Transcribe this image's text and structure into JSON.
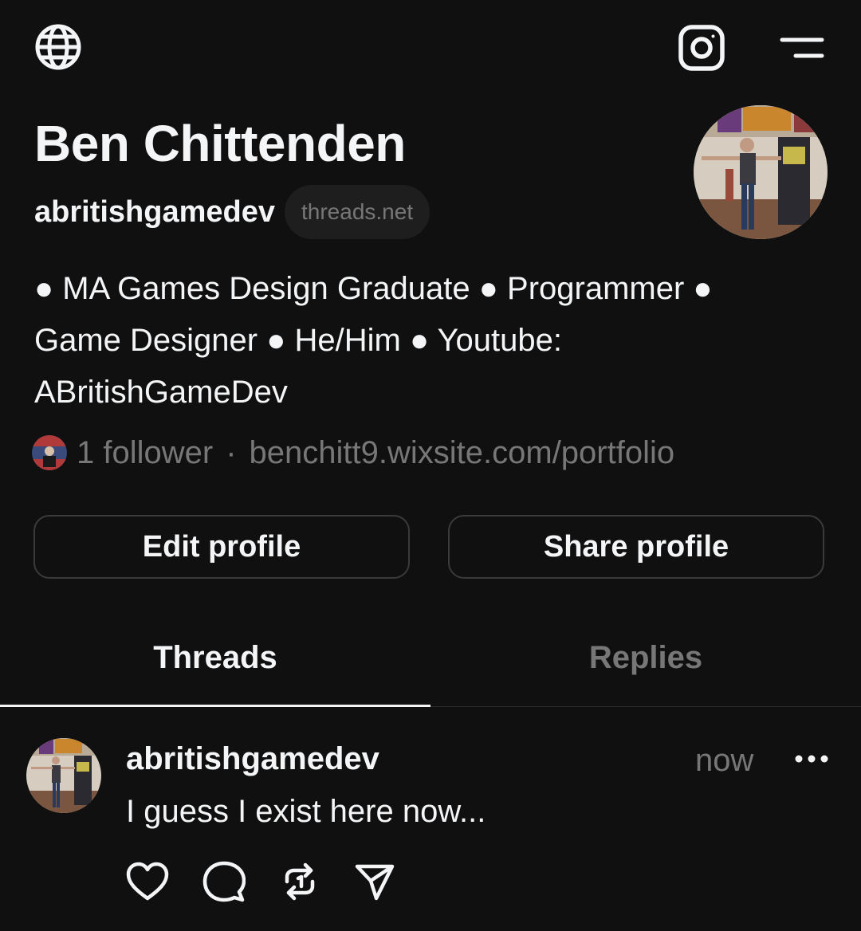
{
  "header": {
    "globe_icon": "globe-icon",
    "instagram_icon": "instagram-icon",
    "menu_icon": "menu-icon"
  },
  "profile": {
    "name": "Ben Chittenden",
    "username": "abritishgamedev",
    "domain_badge": "threads.net",
    "bio": "● MA Games Design Graduate ● Programmer ● Game Designer ● He/Him ● Youtube: ABritishGameDev",
    "followers": "1 follower",
    "separator": "·",
    "link": "benchitt9.wixsite.com/portfolio"
  },
  "buttons": {
    "edit": "Edit profile",
    "share": "Share profile"
  },
  "tabs": [
    {
      "label": "Threads",
      "active": true
    },
    {
      "label": "Replies",
      "active": false
    }
  ],
  "post": {
    "username": "abritishgamedev",
    "time": "now",
    "text": "I guess I exist here now...",
    "actions": [
      "heart-icon",
      "comment-icon",
      "repost-icon",
      "send-icon"
    ]
  },
  "colors": {
    "background": "#101010",
    "text_primary": "#f3f5f7",
    "text_secondary": "#777777",
    "border": "#3a3a3a"
  }
}
